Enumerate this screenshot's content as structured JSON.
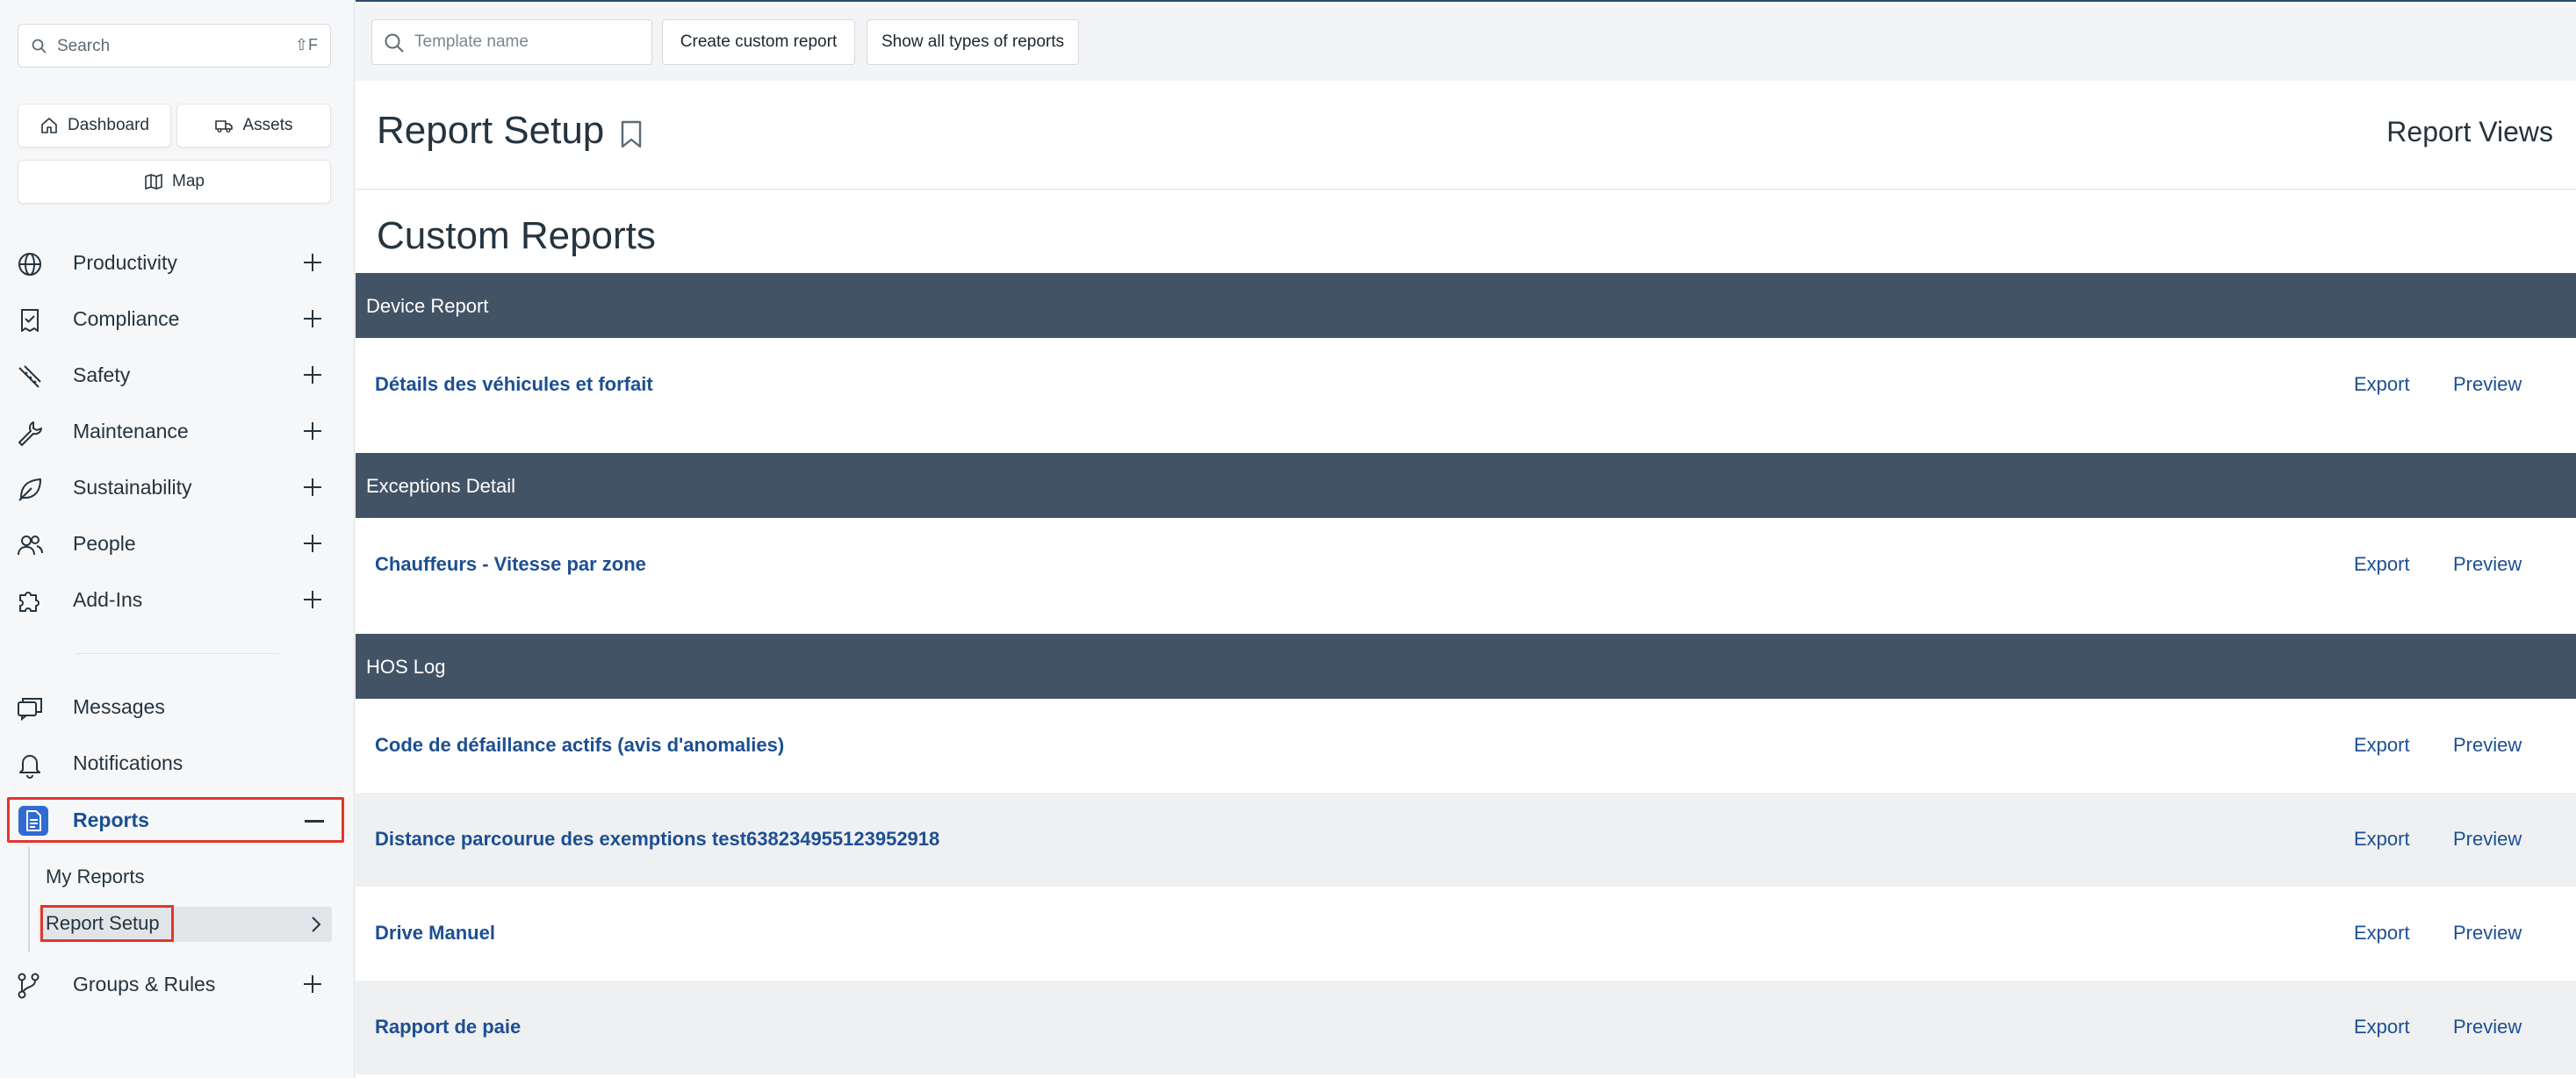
{
  "sidebar": {
    "search": {
      "placeholder": "Search",
      "shortcut": "⇧F"
    },
    "quick_links": {
      "dashboard": "Dashboard",
      "assets": "Assets",
      "map": "Map"
    },
    "items": [
      {
        "label": "Productivity",
        "icon": "globe-icon"
      },
      {
        "label": "Compliance",
        "icon": "clipboard-check-icon"
      },
      {
        "label": "Safety",
        "icon": "road-icon"
      },
      {
        "label": "Maintenance",
        "icon": "wrench-icon"
      },
      {
        "label": "Sustainability",
        "icon": "leaf-icon"
      },
      {
        "label": "People",
        "icon": "people-icon"
      },
      {
        "label": "Add-Ins",
        "icon": "puzzle-icon"
      }
    ],
    "lower_items": [
      {
        "label": "Messages",
        "icon": "messages-icon"
      },
      {
        "label": "Notifications",
        "icon": "bell-icon"
      }
    ],
    "reports": {
      "label": "Reports",
      "icon": "report-document-icon",
      "sub_items": [
        "My Reports",
        "Report Setup"
      ]
    },
    "groups_rules": {
      "label": "Groups & Rules",
      "icon": "groups-rules-icon"
    }
  },
  "toolbar": {
    "template_name_placeholder": "Template name",
    "create_button": "Create custom report",
    "show_all_button": "Show all types of reports"
  },
  "page": {
    "title": "Report Setup",
    "report_views": "Report Views",
    "section_title": "Custom Reports"
  },
  "groups": [
    {
      "name": "Device Report",
      "reports": [
        {
          "name": "Détails des véhicules et forfait"
        }
      ]
    },
    {
      "name": "Exceptions Detail",
      "reports": [
        {
          "name": "Chauffeurs - Vitesse par zone"
        }
      ]
    },
    {
      "name": "HOS Log",
      "reports": [
        {
          "name": "Code de défaillance actifs (avis d'anomalies)"
        },
        {
          "name": "Distance parcourue des exemptions test638234955123952918"
        },
        {
          "name": "Drive Manuel"
        },
        {
          "name": "Rapport de paie"
        }
      ]
    }
  ],
  "actions": {
    "export": "Export",
    "preview": "Preview"
  },
  "colors": {
    "accent": "#2f6bd1",
    "link": "#1d4f92",
    "group_bar": "#435366",
    "highlight": "#e0372b"
  }
}
